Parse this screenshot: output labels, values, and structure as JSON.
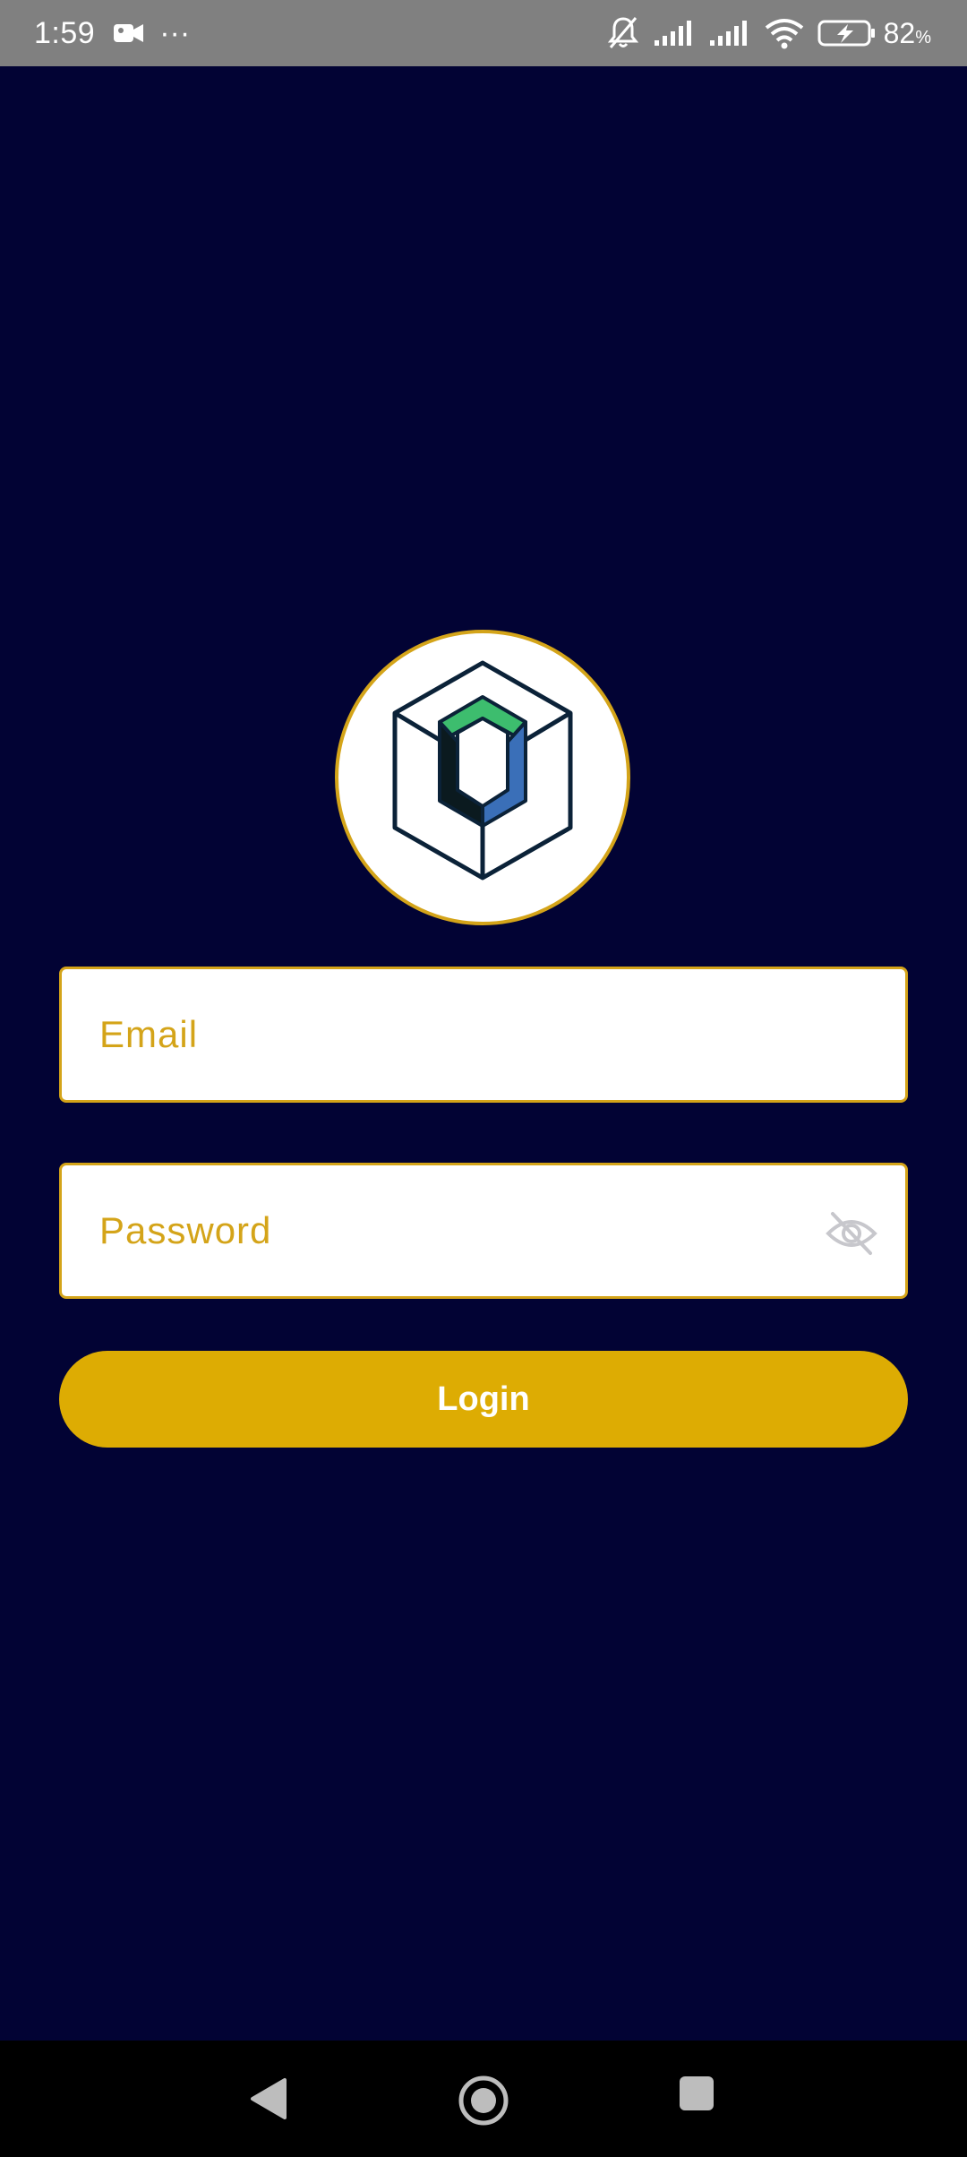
{
  "status_bar": {
    "time": "1:59",
    "dots": "···",
    "battery_percent": "82",
    "battery_unit": "%",
    "icons": [
      "video-camera-icon",
      "bell-off-icon",
      "signal-icon",
      "signal-icon",
      "wifi-icon",
      "battery-charging-icon"
    ]
  },
  "login": {
    "email_placeholder": "Email",
    "password_placeholder": "Password",
    "login_label": "Login"
  },
  "colors": {
    "background": "#020334",
    "accent": "#ddac03",
    "border": "#d4a419",
    "logo_green": "#3dbd6e",
    "logo_blue": "#3a6fb8",
    "logo_dark": "#0b2238"
  },
  "nav": {
    "icons": [
      "back-icon",
      "home-icon",
      "recents-icon"
    ]
  }
}
